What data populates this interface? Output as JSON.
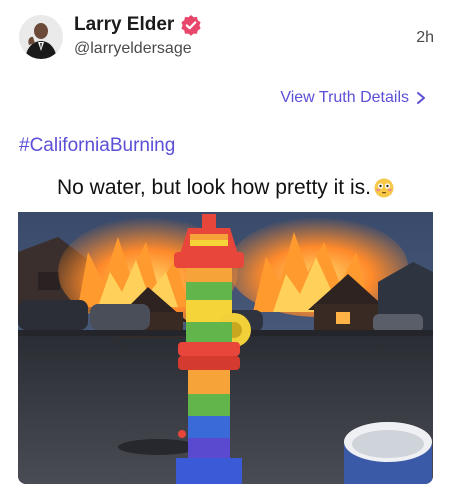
{
  "post": {
    "author_name": "Larry Elder",
    "author_handle": "@larryeldersage",
    "timestamp": "2h",
    "view_details_label": "View Truth Details",
    "hashtag": "#CaliforniaBurning",
    "media_caption": "No water, but look how pretty it is.",
    "caption_emoji": "flushed-face-emoji"
  },
  "icons": {
    "verified": "verified-badge-icon",
    "details_chevron": "chevron-right-icon"
  },
  "colors": {
    "accent": "#5b4fd6",
    "verified": "#e8466b"
  }
}
